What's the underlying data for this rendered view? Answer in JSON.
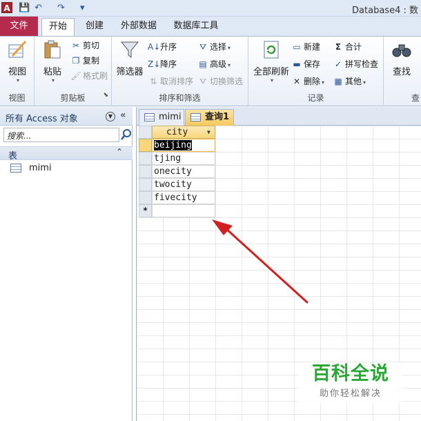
{
  "app": {
    "icon_letter": "A",
    "window_title": "Database4 : 数"
  },
  "quick_access": {
    "save_icon": "💾",
    "undo_icon": "↶",
    "redo_icon": "↷",
    "customize_icon": "▾"
  },
  "ribbon_tabs": [
    "文件",
    "开始",
    "创建",
    "外部数据",
    "数据库工具"
  ],
  "ribbon": {
    "view": {
      "label": "视图",
      "group": "视图"
    },
    "clipboard": {
      "paste": "粘贴",
      "cut": "剪切",
      "copy": "复制",
      "format_painter": "格式刷",
      "group": "剪贴板"
    },
    "sort_filter": {
      "filter": "筛选器",
      "ascending": "升序",
      "descending": "降序",
      "clear_sort": "取消排序",
      "selection": "选择",
      "advanced": "高级",
      "toggle_filter": "切换筛选",
      "group": "排序和筛选"
    },
    "records": {
      "refresh_all": "全部刷新",
      "new": "新建",
      "save": "保存",
      "delete": "删除",
      "totals": "合计",
      "spelling": "拼写检查",
      "more": "其他",
      "group": "记录"
    },
    "find": {
      "find": "查找",
      "group": "查"
    }
  },
  "nav_pane": {
    "title": "所有 Access 对象",
    "search_placeholder": "搜索...",
    "section": "表",
    "items": [
      "mimi"
    ]
  },
  "doc_tabs": [
    "mimi",
    "查询1"
  ],
  "datasheet": {
    "column": "city",
    "rows": [
      "beijing",
      "tjing",
      "onecity",
      "twocity",
      "fivecity"
    ],
    "new_row_marker": "*"
  },
  "watermark": {
    "title": "百科全说",
    "subtitle": "助你轻松解决"
  },
  "colors": {
    "file_tab": "#b42b4e",
    "arrow": "#d02020",
    "active_tab": "#f6c95f",
    "watermark_green": "#2aa836"
  }
}
